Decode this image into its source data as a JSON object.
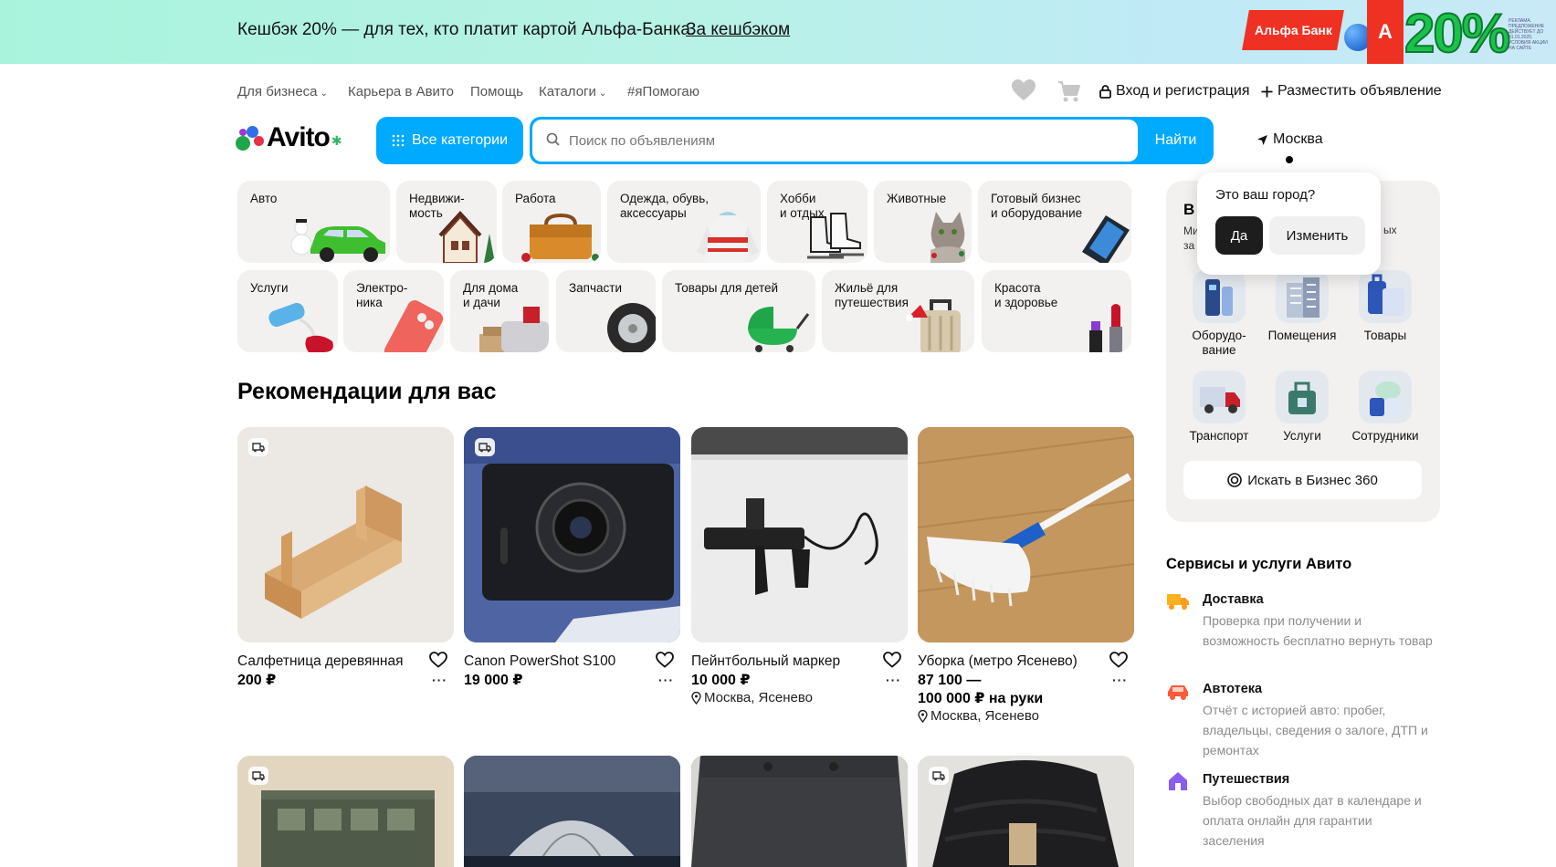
{
  "promo": {
    "text": "Кешбэк 20% — для тех, кто платит картой Альфа-Банка.",
    "link": "За кешбэком",
    "bank": "Альфа Банк",
    "letter": "А",
    "percent": "20%",
    "fine_print": "РЕКЛАМА. ПРЕДЛОЖЕНИЕ ДЕЙСТВУЕТ ДО 31.01.2025. УСЛОВИЯ АКЦИИ НА САЙТЕ"
  },
  "topnav": {
    "business": "Для бизнеса",
    "career": "Карьера в Авито",
    "help": "Помощь",
    "catalogs": "Каталоги",
    "ipomogayu": "#яПомогаю",
    "login": "Вход и регистрация",
    "post_ad": "Разместить объявление"
  },
  "header": {
    "logo": "Avito",
    "all_categories": "Все категории",
    "search_placeholder": "Поиск по объявлениям",
    "search_button": "Найти",
    "city": "Москва"
  },
  "categories_row1": [
    {
      "label": "Авто"
    },
    {
      "label": "Недвижи-\nмость"
    },
    {
      "label": "Работа"
    },
    {
      "label": "Одежда, обувь,\nаксессуары"
    },
    {
      "label": "Хобби\nи отдых"
    },
    {
      "label": "Животные"
    },
    {
      "label": "Готовый бизнес\nи оборудование"
    }
  ],
  "categories_row2": [
    {
      "label": "Услуги"
    },
    {
      "label": "Электро-\nника"
    },
    {
      "label": "Для дома\nи дачи"
    },
    {
      "label": "Запчасти"
    },
    {
      "label": "Товары для детей"
    },
    {
      "label": "Жильё для\nпутешествия"
    },
    {
      "label": "Красота\nи здоровье"
    }
  ],
  "recommendations": {
    "title": "Рекомендации для вас",
    "items": [
      {
        "title": "Салфетница деревянная",
        "price": "200 ₽",
        "location": ""
      },
      {
        "title": "Canon PowerShot S100",
        "price": "19 000 ₽",
        "location": ""
      },
      {
        "title": "Пейнтбольный маркер",
        "price": "10 000 ₽",
        "location": "Москва, Ясенево"
      },
      {
        "title": "Уборка (метро Ясенево)",
        "price": "87 100 —",
        "price2": "100 000 ₽ на руки",
        "location": "Москва, Ясенево"
      }
    ]
  },
  "city_popup": {
    "question": "Это ваш город?",
    "yes": "Да",
    "change": "Изменить"
  },
  "business_panel": {
    "head_bold": "В",
    "head_sub_1": "Ми",
    "head_sub_2": "за",
    "head_right": "ых",
    "items": [
      {
        "label": "Оборудо-\nвание"
      },
      {
        "label": "Помещения"
      },
      {
        "label": "Товары"
      },
      {
        "label": "Транспорт"
      },
      {
        "label": "Услуги"
      },
      {
        "label": "Сотрудники"
      }
    ],
    "search_button": "Искать в Бизнес 360"
  },
  "services": {
    "title": "Сервисы и услуги Авито",
    "items": [
      {
        "name": "Доставка",
        "desc": "Проверка при получении и возможность бесплатно вернуть товар"
      },
      {
        "name": "Автотека",
        "desc": "Отчёт с историей авто: пробег, владельцы, сведения о залоге, ДТП и ремонтах"
      },
      {
        "name": "Путешествия",
        "desc": "Выбор свободных дат в календаре и оплата онлайн для гарантии заселения"
      }
    ]
  },
  "colors": {
    "accent": "#00aaff",
    "tile_bg": "#f2f1f0",
    "alfa_red": "#ef3124"
  }
}
